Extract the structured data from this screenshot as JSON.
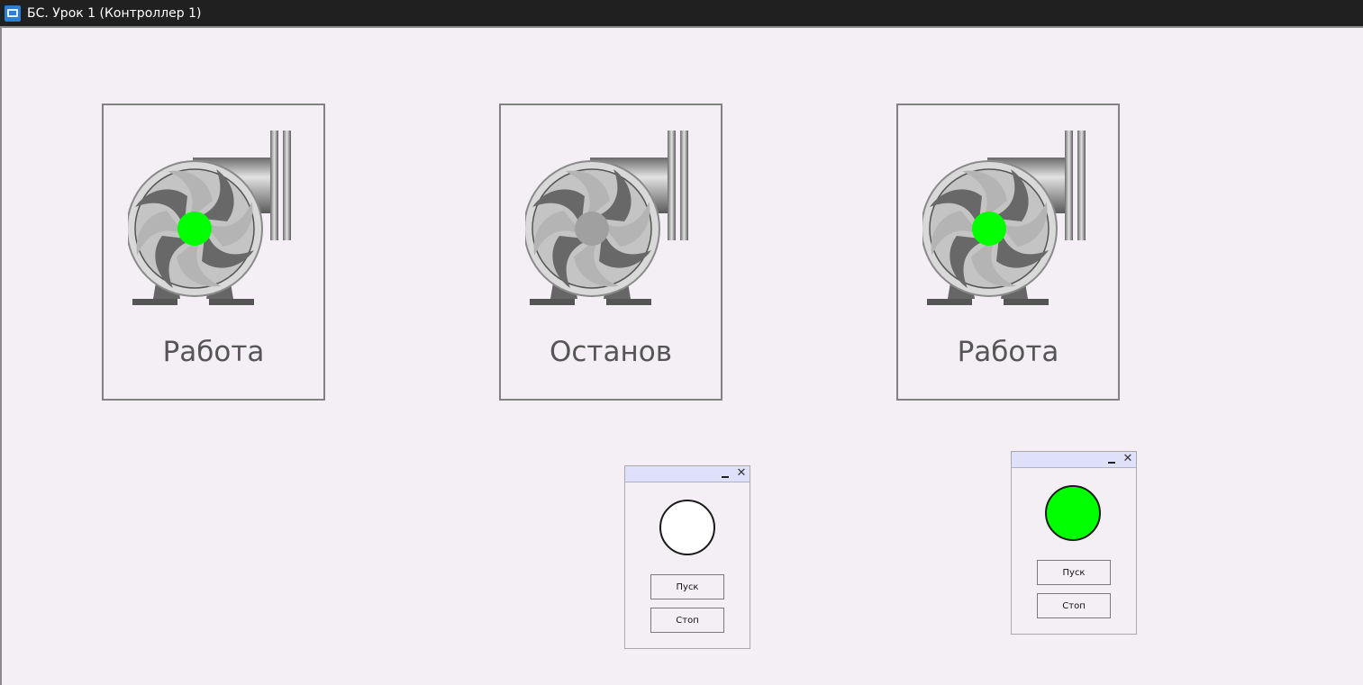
{
  "window": {
    "title": "БС. Урок 1 (Контроллер 1)"
  },
  "colors": {
    "running": "#00ff00",
    "stopped": "#a0a0a0",
    "lamp_off": "#ffffff",
    "background": "#f3eff5"
  },
  "pumps": [
    {
      "status": "Работа",
      "state": "running"
    },
    {
      "status": "Останов",
      "state": "stopped"
    },
    {
      "status": "Работа",
      "state": "running"
    }
  ],
  "controls": [
    {
      "lamp_state": "off",
      "start_label": "Пуск",
      "stop_label": "Стоп",
      "minimize_icon": "minimize-icon",
      "close_icon": "close-icon"
    },
    {
      "lamp_state": "on",
      "start_label": "Пуск",
      "stop_label": "Стоп",
      "minimize_icon": "minimize-icon",
      "close_icon": "close-icon"
    }
  ],
  "icons": {
    "app": "app-icon",
    "pump": "pump-icon"
  }
}
